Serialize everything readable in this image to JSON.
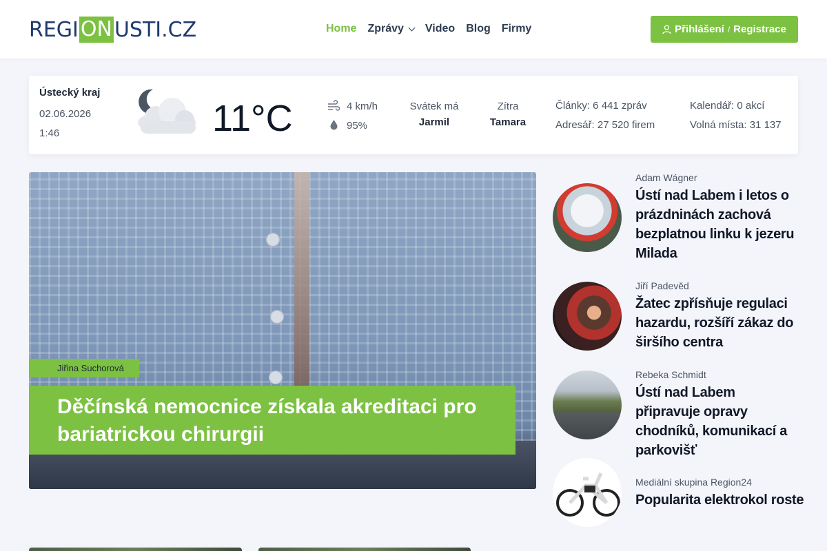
{
  "header": {
    "logo": {
      "part1": "REGI",
      "part2": "ON",
      "part3": "USTI.CZ"
    },
    "nav": [
      {
        "label": "Home",
        "active": true
      },
      {
        "label": "Zprávy",
        "has_dropdown": true
      },
      {
        "label": "Video"
      },
      {
        "label": "Blog"
      },
      {
        "label": "Firmy"
      }
    ],
    "login": {
      "login_label": "Přihlášení",
      "separator": "/",
      "register_label": "Registrace",
      "icon": "user-icon"
    }
  },
  "infobar": {
    "region": "Ústecký kraj",
    "date": "02.06.2026",
    "time": "1:46",
    "weather_icon": "cloudy-night-icon",
    "temperature": "11°C",
    "wind": "4 km/h",
    "humidity": "95%",
    "nameday_label": "Svátek má",
    "nameday_name": "Jarmil",
    "tomorrow_label": "Zítra",
    "tomorrow_name": "Tamara",
    "articles": "Články: 6 441 zpráv",
    "directory": "Adresář: 27 520 firem",
    "calendar": "Kalendář: 0 akcí",
    "jobs": "Volná místa: 31 137"
  },
  "hero": {
    "author": "Jiřina Suchorová",
    "title": "Děčínská nemocnice získala akreditaci pro bariatrickou chirurgii"
  },
  "side_articles": [
    {
      "author": "Adam Wágner",
      "title": "Ústí nad Labem i letos o prázdninách zachová bezplatnou linku k jezeru Milada"
    },
    {
      "author": "Jiří Padevěd",
      "title": "Žatec zpřísňuje regulaci hazardu, rozšíří zákaz do širšího centra"
    },
    {
      "author": "Rebeka Schmidt",
      "title": "Ústí nad Labem připravuje opravy chodníků, komunikací a parkovišť"
    },
    {
      "author": "Mediální skupina Region24",
      "title": "Popularita elektrokol roste"
    }
  ],
  "colors": {
    "accent": "#7cc142",
    "brand_dark": "#1e3a6e",
    "background": "#f3f5fb"
  }
}
